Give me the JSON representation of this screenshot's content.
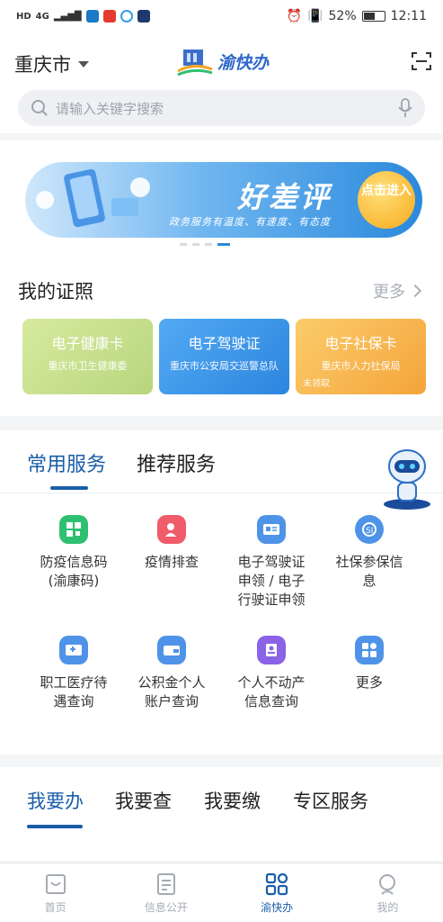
{
  "status_bar": {
    "network": "HD",
    "signal": "4G",
    "battery": "52%",
    "time": "12:11"
  },
  "header": {
    "city": "重庆市",
    "logo_text": "渝快办",
    "search_placeholder": "请输入关键字搜索"
  },
  "banner": {
    "title": "好差评",
    "subtitle": "政务服务有温度、有速度、有态度",
    "button": "点击进入",
    "active_dot": 4,
    "dot_count": 4
  },
  "certificates": {
    "title": "我的证照",
    "more": "更多",
    "cards": [
      {
        "title": "电子健康卡",
        "issuer": "重庆市卫生健康委",
        "tag": ""
      },
      {
        "title": "电子驾驶证",
        "issuer": "重庆市公安局交巡警总队",
        "tag": ""
      },
      {
        "title": "电子社保卡",
        "issuer": "重庆市人力社保局",
        "tag": "未领取"
      }
    ]
  },
  "services": {
    "tabs": [
      "常用服务",
      "推荐服务"
    ],
    "active_tab": "常用服务",
    "items": [
      {
        "label": "防疫信息码\n(渝康码)",
        "icon": "qr-code-icon",
        "color": "#2fbf71"
      },
      {
        "label": "疫情排查",
        "icon": "person-search-icon",
        "color": "#f05c6a"
      },
      {
        "label": "电子驾驶证\n申领 / 电子\n行驶证申领",
        "icon": "license-card-icon",
        "color": "#4f93e8"
      },
      {
        "label": "社保参保信\n息",
        "icon": "social-security-icon",
        "color": "#4f93e8"
      },
      {
        "label": "职工医疗待\n遇查询",
        "icon": "medical-card-icon",
        "color": "#4f93e8"
      },
      {
        "label": "公积金个人\n账户查询",
        "icon": "wallet-icon",
        "color": "#4f93e8"
      },
      {
        "label": "个人不动产\n信息查询",
        "icon": "property-icon",
        "color": "#8a63e6"
      },
      {
        "label": "更多",
        "icon": "grid-more-icon",
        "color": "#4f93e8"
      }
    ]
  },
  "lower_tabs": [
    "我要办",
    "我要查",
    "我要缴",
    "专区服务"
  ],
  "lower_active": "我要办",
  "nav": [
    {
      "label": "首页",
      "icon": "home-icon",
      "active": false
    },
    {
      "label": "信息公开",
      "icon": "document-icon",
      "active": false
    },
    {
      "label": "渝快办",
      "icon": "apps-grid-icon",
      "active": true
    },
    {
      "label": "我的",
      "icon": "profile-icon",
      "active": false
    }
  ],
  "colors": {
    "accent": "#1a5ea8",
    "banner_blue": "#2b89dc",
    "muted": "#a5abb3"
  }
}
